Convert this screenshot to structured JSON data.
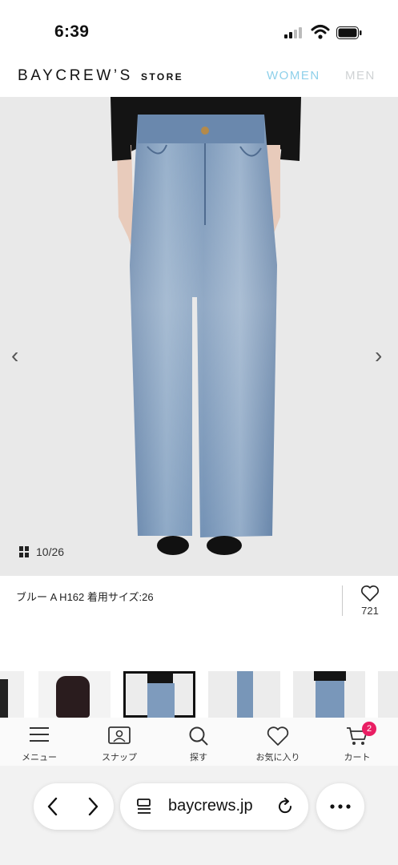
{
  "status": {
    "time": "6:39"
  },
  "header": {
    "brand": "BAYCREW’S",
    "brand_suffix": "STORE",
    "tabs": [
      "WOMEN",
      "MEN"
    ],
    "tab_colors": {
      "active": "#8ed0ea",
      "inactive": "#cfd2d4"
    }
  },
  "gallery": {
    "counter": "10/26",
    "prev_icon": "chevron-left-icon",
    "next_icon": "chevron-right-icon"
  },
  "product": {
    "caption": "ブルー A H162 着用サイズ:26",
    "favorite_count": "721"
  },
  "tabbar": {
    "items": [
      {
        "label": "メニュー",
        "icon": "menu-icon"
      },
      {
        "label": "スナップ",
        "icon": "snap-icon"
      },
      {
        "label": "探す",
        "icon": "search-icon"
      },
      {
        "label": "お気に入り",
        "icon": "heart-icon"
      },
      {
        "label": "カート",
        "icon": "cart-icon"
      }
    ],
    "cart_badge": "2",
    "badge_color": "#e91e63"
  },
  "browser": {
    "url": "baycrews.jp"
  }
}
